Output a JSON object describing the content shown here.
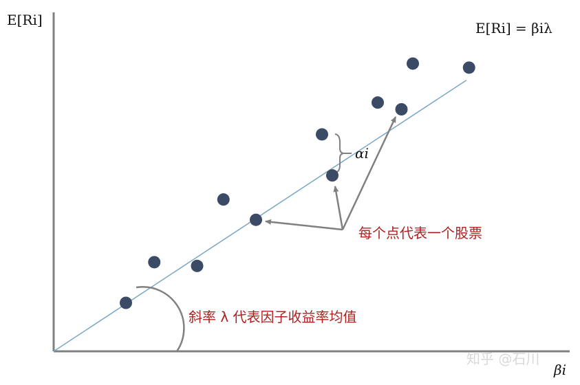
{
  "chart_data": {
    "type": "scatter",
    "title": "",
    "xlabel": "βi",
    "ylabel": "E[Ri]",
    "xlim": [
      0,
      10
    ],
    "ylim": [
      0,
      10
    ],
    "line": {
      "label": "E[Ri] = βiλ",
      "slope": 1.0,
      "intercept": 0.0
    },
    "points": [
      {
        "x": 1.4,
        "y": 1.43
      },
      {
        "x": 1.95,
        "y": 2.63
      },
      {
        "x": 2.78,
        "y": 2.52
      },
      {
        "x": 3.29,
        "y": 4.48
      },
      {
        "x": 3.92,
        "y": 3.88
      },
      {
        "x": 5.2,
        "y": 6.4
      },
      {
        "x": 5.4,
        "y": 5.19
      },
      {
        "x": 6.28,
        "y": 7.34
      },
      {
        "x": 6.74,
        "y": 7.14
      },
      {
        "x": 6.96,
        "y": 8.49
      },
      {
        "x": 8.05,
        "y": 8.37
      }
    ],
    "alpha_label": "αi",
    "annotations": {
      "points_note": "每个点代表一个股票",
      "slope_note": "斜率 λ 代表因子收益率均值"
    },
    "grid": false,
    "legend": "none"
  },
  "watermark": "知乎 @石川",
  "colors": {
    "point": "#3b4b66",
    "line": "#7aa8c4",
    "axis": "#808080",
    "note": "#b02020"
  }
}
